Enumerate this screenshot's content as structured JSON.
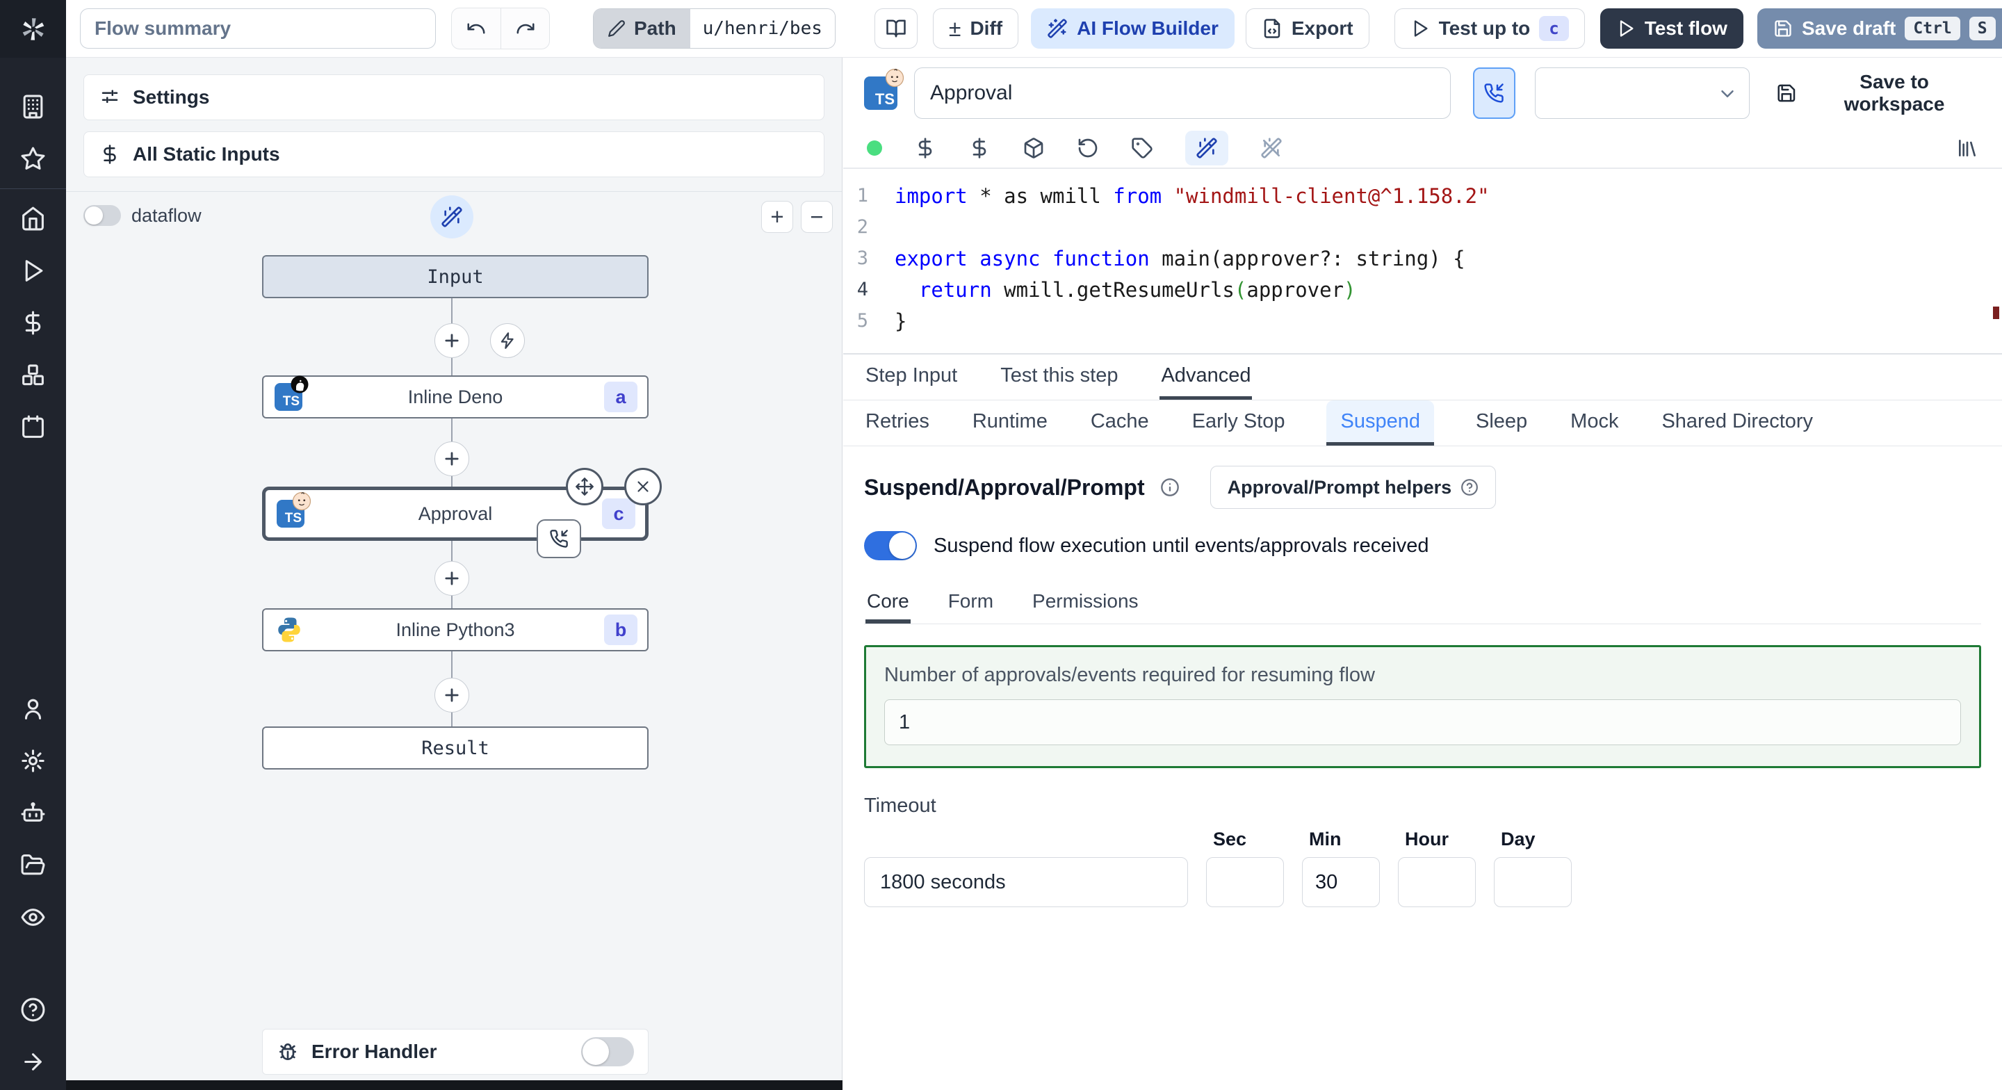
{
  "topbar": {
    "flow_summary_placeholder": "Flow summary",
    "path_label": "Path",
    "path_value": "u/henri/bes",
    "diff_label": "Diff",
    "diff_glyph": "±",
    "ai_flow_builder_label": "AI Flow Builder",
    "export_label": "Export",
    "test_up_to_label": "Test up to",
    "test_up_to_key": "c",
    "test_flow_label": "Test flow",
    "save_draft_label": "Save draft",
    "save_draft_keys": [
      "Ctrl",
      "S"
    ]
  },
  "left_panel": {
    "settings_label": "Settings",
    "static_inputs_label": "All Static Inputs",
    "dataflow_label": "dataflow",
    "zoom_in_label": "+",
    "zoom_out_label": "−",
    "nodes": {
      "input_label": "Input",
      "deno_label": "Inline Deno",
      "deno_badge": "a",
      "approval_label": "Approval",
      "approval_badge": "c",
      "python_label": "Inline Python3",
      "python_badge": "b",
      "result_label": "Result"
    },
    "error_handler_label": "Error Handler"
  },
  "editor": {
    "step_name_value": "Approval",
    "save_to_workspace_label": "Save to workspace",
    "tabs_primary": [
      {
        "label": "Step Input"
      },
      {
        "label": "Test this step"
      },
      {
        "label": "Advanced",
        "active": true
      }
    ],
    "tabs_advanced": [
      {
        "label": "Retries"
      },
      {
        "label": "Runtime"
      },
      {
        "label": "Cache"
      },
      {
        "label": "Early Stop"
      },
      {
        "label": "Suspend",
        "active": true,
        "highlight": true
      },
      {
        "label": "Sleep"
      },
      {
        "label": "Mock"
      },
      {
        "label": "Shared Directory"
      }
    ],
    "code": {
      "lines": [
        {
          "n": "1",
          "segs": [
            [
              "kw",
              "import"
            ],
            [
              "pl",
              " * as wmill "
            ],
            [
              "kw",
              "from"
            ],
            [
              "st",
              " \"windmill-client@^1.158.2\""
            ]
          ]
        },
        {
          "n": "2",
          "segs": []
        },
        {
          "n": "3",
          "segs": [
            [
              "kw",
              "export async function"
            ],
            [
              "pl",
              " main(approver?: string) "
            ],
            [
              "br",
              "{"
            ]
          ]
        },
        {
          "n": "4",
          "segs": [
            [
              "pl",
              "  "
            ],
            [
              "kw",
              "return"
            ],
            [
              "pl",
              " wmill.getResumeUrls"
            ],
            [
              "gr",
              "("
            ],
            [
              "pl",
              "approver"
            ],
            [
              "gr",
              ")"
            ]
          ],
          "current": true
        },
        {
          "n": "5",
          "segs": [
            [
              "br",
              "}"
            ]
          ]
        }
      ]
    }
  },
  "suspend": {
    "heading": "Suspend/Approval/Prompt",
    "helpers_label": "Approval/Prompt helpers",
    "toggle_label": "Suspend flow execution until events/approvals received",
    "tabs": [
      {
        "label": "Core",
        "active": true
      },
      {
        "label": "Form"
      },
      {
        "label": "Permissions"
      }
    ],
    "approvals_label": "Number of approvals/events required for resuming flow",
    "approvals_value": "1",
    "timeout_label": "Timeout",
    "timeout_value": "1800 seconds",
    "units": [
      {
        "label": "Sec",
        "value": ""
      },
      {
        "label": "Min",
        "value": "30"
      },
      {
        "label": "Hour",
        "value": ""
      },
      {
        "label": "Day",
        "value": ""
      }
    ]
  },
  "colors": {
    "accent_blue": "#3b82f6",
    "toggle_on": "#2f6fe0",
    "save_draft_bg": "#758cac",
    "test_flow_bg": "#2d3748",
    "ai_builder_bg": "#dbeafe",
    "badge_bg": "#e0e7fd",
    "badge_text": "#4040cc",
    "green_border": "#1e7a35",
    "code_keyword": "#0000ff",
    "code_string": "#a31515",
    "sidebar_bg": "#20242d"
  },
  "icons": {
    "sidebar": [
      "building",
      "star",
      "home",
      "play",
      "dollar-sign",
      "boxes",
      "calendar",
      "user",
      "gear",
      "robot",
      "folder-open",
      "eye",
      "help-circle",
      "arrow-right"
    ],
    "topbar": [
      "windmill-logo",
      "undo",
      "redo",
      "pencil",
      "book-open",
      "plus-minus",
      "wand-sparkles",
      "file-code",
      "play",
      "save"
    ],
    "editor_toolbar": [
      "status-dot",
      "dollar-sign",
      "dollar-sign",
      "package",
      "rotate-ccw",
      "tag",
      "wand-sparkles-active",
      "wand-off",
      "library"
    ],
    "flow_graph": [
      "plus-circle",
      "bolt-circle",
      "typescript-badge",
      "deno-logo",
      "baby-face",
      "python-logo",
      "move-arrows",
      "close-x",
      "phone-incoming",
      "bug"
    ],
    "misc": [
      "info-circle",
      "help-circle",
      "chevron-down",
      "save",
      "sliders"
    ]
  }
}
